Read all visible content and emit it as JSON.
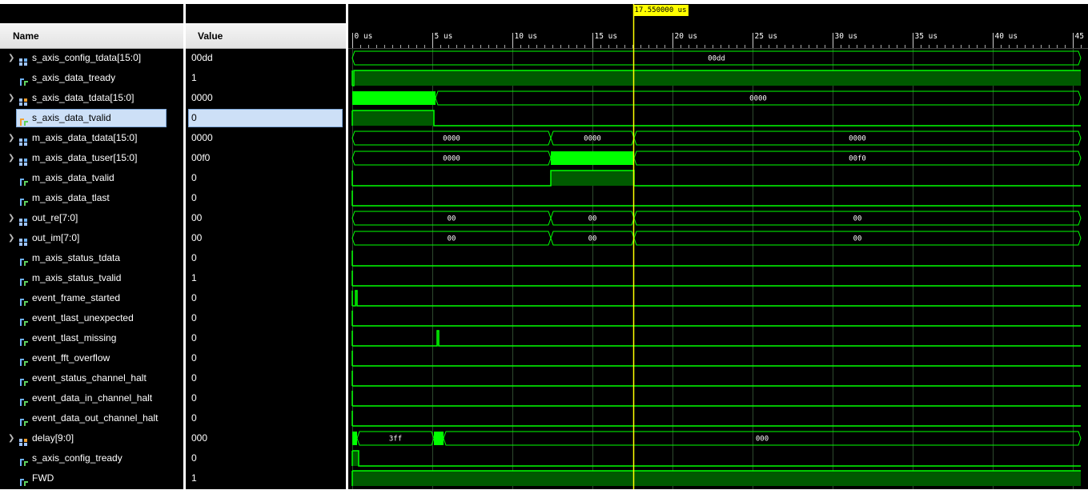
{
  "columns": {
    "name": "Name",
    "value": "Value"
  },
  "cursor": {
    "label": "17.550000 us",
    "time_us": 17.55
  },
  "timeline": {
    "start_us": 0,
    "end_us": 45.5,
    "ticks": [
      {
        "t": 0,
        "label": "0 us"
      },
      {
        "t": 5,
        "label": "5 us"
      },
      {
        "t": 10,
        "label": "10 us"
      },
      {
        "t": 15,
        "label": "15 us"
      },
      {
        "t": 20,
        "label": "20 us"
      },
      {
        "t": 25,
        "label": "25 us"
      },
      {
        "t": 30,
        "label": "30 us"
      },
      {
        "t": 35,
        "label": "35 us"
      },
      {
        "t": 40,
        "label": "40 us"
      },
      {
        "t": 45,
        "label": "45"
      }
    ]
  },
  "selected_signal": "s_axis_data_tvalid",
  "signals": [
    {
      "name": "s_axis_config_tdata[15:0]",
      "value": "00dd",
      "bus": true,
      "icon": "bus-icon",
      "wave": {
        "kind": "bus",
        "segs": [
          {
            "s": 0,
            "e": 45.5,
            "label": "00dd"
          }
        ]
      }
    },
    {
      "name": "s_axis_data_tready",
      "value": "1",
      "bus": false,
      "icon": "bit-icon",
      "wave": {
        "kind": "bit",
        "segs": [
          {
            "s": 0,
            "e": 0.1,
            "v": 0
          },
          {
            "s": 0.1,
            "e": 45.5,
            "v": 1
          }
        ]
      }
    },
    {
      "name": "s_axis_data_tdata[15:0]",
      "value": "0000",
      "bus": true,
      "icon": "bus-icon-orange",
      "wave": {
        "kind": "bus",
        "segs": [
          {
            "s": 0,
            "e": 5.2,
            "label": "",
            "dense": true
          },
          {
            "s": 5.2,
            "e": 45.5,
            "label": "0000"
          }
        ]
      }
    },
    {
      "name": "s_axis_data_tvalid",
      "value": "0",
      "bus": false,
      "icon": "bit-icon-orange",
      "wave": {
        "kind": "bit",
        "segs": [
          {
            "s": 0,
            "e": 5.1,
            "v": 1
          },
          {
            "s": 5.1,
            "e": 45.5,
            "v": 0
          }
        ]
      }
    },
    {
      "name": "m_axis_data_tdata[15:0]",
      "value": "0000",
      "bus": true,
      "icon": "bus-icon",
      "wave": {
        "kind": "bus",
        "segs": [
          {
            "s": 0,
            "e": 12.4,
            "label": "0000"
          },
          {
            "s": 12.4,
            "e": 17.6,
            "label": "0000"
          },
          {
            "s": 17.6,
            "e": 45.5,
            "label": "0000"
          }
        ]
      }
    },
    {
      "name": "m_axis_data_tuser[15:0]",
      "value": "00f0",
      "bus": true,
      "icon": "bus-icon",
      "wave": {
        "kind": "bus",
        "segs": [
          {
            "s": 0,
            "e": 12.4,
            "label": "0000"
          },
          {
            "s": 12.4,
            "e": 17.6,
            "label": "",
            "dense": true
          },
          {
            "s": 17.6,
            "e": 45.5,
            "label": "00f0"
          }
        ]
      }
    },
    {
      "name": "m_axis_data_tvalid",
      "value": "0",
      "bus": false,
      "icon": "bit-icon",
      "wave": {
        "kind": "bit",
        "segs": [
          {
            "s": 0,
            "e": 12.4,
            "v": 0
          },
          {
            "s": 12.4,
            "e": 17.6,
            "v": 1
          },
          {
            "s": 17.6,
            "e": 45.5,
            "v": 0
          }
        ]
      }
    },
    {
      "name": "m_axis_data_tlast",
      "value": "0",
      "bus": false,
      "icon": "bit-icon",
      "wave": {
        "kind": "bit",
        "segs": [
          {
            "s": 0,
            "e": 45.5,
            "v": 0
          }
        ]
      }
    },
    {
      "name": "out_re[7:0]",
      "value": "00",
      "bus": true,
      "icon": "bus-icon",
      "wave": {
        "kind": "bus",
        "segs": [
          {
            "s": 0,
            "e": 12.4,
            "label": "00"
          },
          {
            "s": 12.4,
            "e": 17.6,
            "label": "00"
          },
          {
            "s": 17.6,
            "e": 45.5,
            "label": "00"
          }
        ]
      }
    },
    {
      "name": "out_im[7:0]",
      "value": "00",
      "bus": true,
      "icon": "bus-icon",
      "wave": {
        "kind": "bus",
        "segs": [
          {
            "s": 0,
            "e": 12.4,
            "label": "00"
          },
          {
            "s": 12.4,
            "e": 17.6,
            "label": "00"
          },
          {
            "s": 17.6,
            "e": 45.5,
            "label": "00"
          }
        ]
      }
    },
    {
      "name": "m_axis_status_tdata",
      "value": "0",
      "bus": false,
      "icon": "bit-icon",
      "wave": {
        "kind": "bit",
        "segs": [
          {
            "s": 0,
            "e": 45.5,
            "v": 0
          }
        ]
      }
    },
    {
      "name": "m_axis_status_tvalid",
      "value": "1",
      "bus": false,
      "icon": "bit-icon",
      "wave": {
        "kind": "bit",
        "segs": [
          {
            "s": 0,
            "e": 45.5,
            "v": 0
          }
        ]
      }
    },
    {
      "name": "event_frame_started",
      "value": "0",
      "bus": false,
      "icon": "bit-icon",
      "wave": {
        "kind": "bit",
        "segs": [
          {
            "s": 0,
            "e": 0.2,
            "v": 0
          },
          {
            "s": 0.2,
            "e": 0.3,
            "v": 1
          },
          {
            "s": 0.3,
            "e": 45.5,
            "v": 0
          }
        ]
      }
    },
    {
      "name": "event_tlast_unexpected",
      "value": "0",
      "bus": false,
      "icon": "bit-icon",
      "wave": {
        "kind": "bit",
        "segs": [
          {
            "s": 0,
            "e": 45.5,
            "v": 0
          }
        ]
      }
    },
    {
      "name": "event_tlast_missing",
      "value": "0",
      "bus": false,
      "icon": "bit-icon",
      "wave": {
        "kind": "bit",
        "segs": [
          {
            "s": 0,
            "e": 5.3,
            "v": 0
          },
          {
            "s": 5.3,
            "e": 5.4,
            "v": 1
          },
          {
            "s": 5.4,
            "e": 45.5,
            "v": 0
          }
        ]
      }
    },
    {
      "name": "event_fft_overflow",
      "value": "0",
      "bus": false,
      "icon": "bit-icon",
      "wave": {
        "kind": "bit",
        "segs": [
          {
            "s": 0,
            "e": 45.5,
            "v": 0
          }
        ]
      }
    },
    {
      "name": "event_status_channel_halt",
      "value": "0",
      "bus": false,
      "icon": "bit-icon",
      "wave": {
        "kind": "bit",
        "segs": [
          {
            "s": 0,
            "e": 45.5,
            "v": 0
          }
        ]
      }
    },
    {
      "name": "event_data_in_channel_halt",
      "value": "0",
      "bus": false,
      "icon": "bit-icon",
      "wave": {
        "kind": "bit",
        "segs": [
          {
            "s": 0,
            "e": 45.5,
            "v": 0
          }
        ]
      }
    },
    {
      "name": "event_data_out_channel_halt",
      "value": "0",
      "bus": false,
      "icon": "bit-icon",
      "wave": {
        "kind": "bit",
        "segs": [
          {
            "s": 0,
            "e": 45.5,
            "v": 0
          }
        ]
      }
    },
    {
      "name": "delay[9:0]",
      "value": "000",
      "bus": true,
      "icon": "bus-icon-orange",
      "wave": {
        "kind": "bus",
        "segs": [
          {
            "s": 0,
            "e": 0.3,
            "label": "",
            "dense": true
          },
          {
            "s": 0.3,
            "e": 5.1,
            "label": "3ff"
          },
          {
            "s": 5.1,
            "e": 5.7,
            "label": "",
            "dense": true
          },
          {
            "s": 5.7,
            "e": 45.5,
            "label": "000"
          }
        ]
      }
    },
    {
      "name": "s_axis_config_tready",
      "value": "0",
      "bus": false,
      "icon": "bit-icon",
      "wave": {
        "kind": "bit",
        "segs": [
          {
            "s": 0,
            "e": 0.4,
            "v": 1
          },
          {
            "s": 0.4,
            "e": 45.5,
            "v": 0
          }
        ]
      }
    },
    {
      "name": "FWD",
      "value": "1",
      "bus": false,
      "icon": "bit-icon",
      "wave": {
        "kind": "bit",
        "segs": [
          {
            "s": 0,
            "e": 45.5,
            "v": 1
          }
        ]
      }
    }
  ],
  "colors": {
    "wave": "#00ff00",
    "wave_fill": "#005a00",
    "cursor": "#ffff00",
    "grid": "#2e4a2e",
    "selection": "#cde0f7"
  }
}
